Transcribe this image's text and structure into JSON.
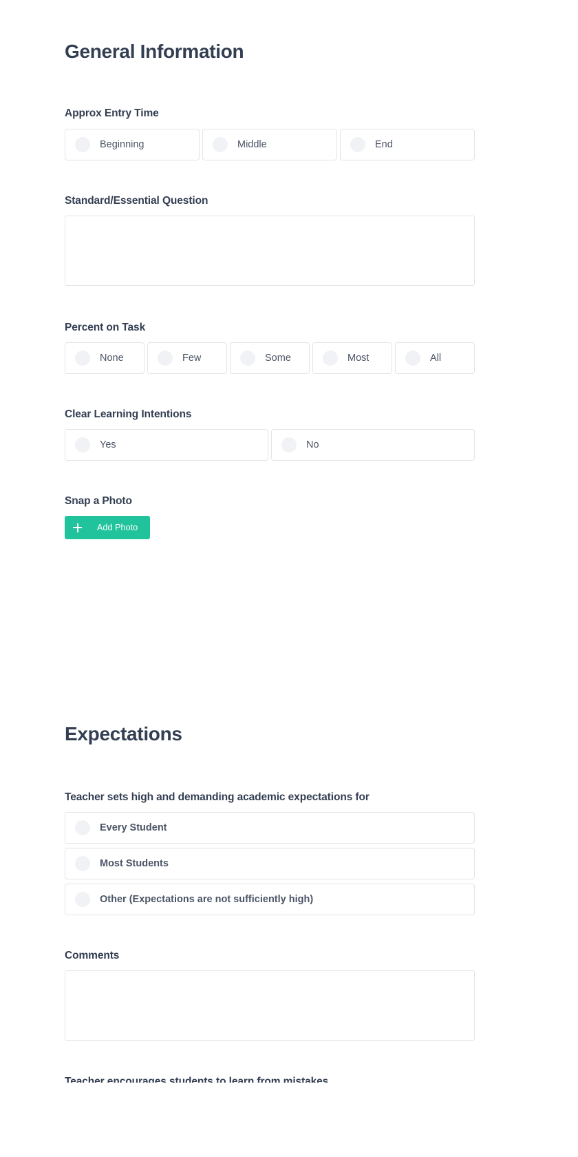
{
  "sections": [
    {
      "id": "general",
      "title": "General Information"
    },
    {
      "id": "expectations",
      "title": "Expectations"
    }
  ],
  "general": {
    "title": "General Information",
    "entry_time": {
      "label": "Approx Entry Time",
      "options": [
        "Beginning",
        "Middle",
        "End"
      ]
    },
    "standard_question": {
      "label": "Standard/Essential Question",
      "value": "",
      "placeholder": ""
    },
    "percent_on_task": {
      "label": "Percent on Task",
      "options": [
        "None",
        "Few",
        "Some",
        "Most",
        "All"
      ]
    },
    "clear_learning_intentions": {
      "label": "Clear Learning Intentions",
      "options": [
        "Yes",
        "No"
      ]
    },
    "snap_photo": {
      "label": "Snap a Photo",
      "button_label": "Add Photo",
      "button_icon": "plus-icon",
      "button_color": "#20c39b"
    }
  },
  "expectations": {
    "title": "Expectations",
    "academic_expectations": {
      "label": "Teacher sets high and demanding academic expectations for",
      "options": [
        "Every Student",
        "Most Students",
        "Other (Expectations are not sufficiently high)"
      ]
    },
    "comments": {
      "label": "Comments",
      "value": "",
      "placeholder": ""
    },
    "next_question_partial": {
      "label": "Teacher encourages students to learn from mistakes"
    }
  },
  "theme": {
    "heading_color": "#333e52",
    "label_color": "#333e52",
    "option_text_color": "#4c5566",
    "border_color": "#e2e4e8",
    "radio_fill": "#f0f2f5",
    "accent": "#20c39b",
    "background": "#ffffff"
  }
}
